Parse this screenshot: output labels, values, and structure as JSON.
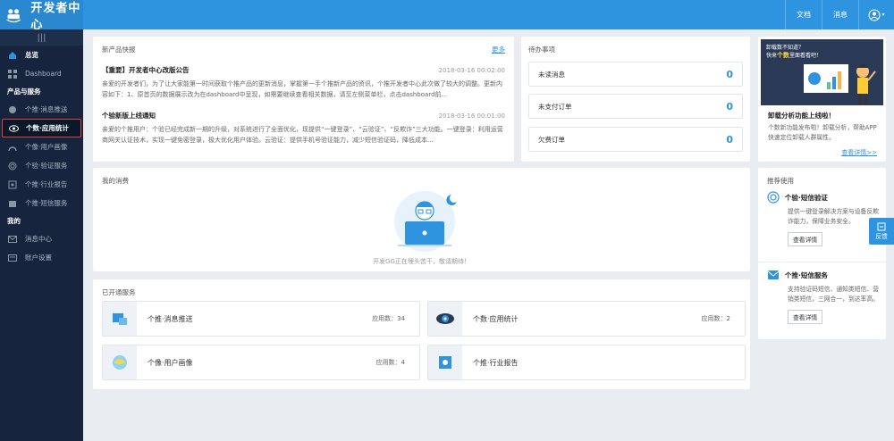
{
  "app": {
    "title": "开发者中心"
  },
  "topbar": {
    "docs": "文档",
    "messages": "消息"
  },
  "sidebar": {
    "collapse": "|||",
    "overview": "总览",
    "dashboard": "Dashboard",
    "group_products": "产品与服务",
    "products": [
      {
        "label": "个推·消息推送"
      },
      {
        "label": "个数·应用统计"
      },
      {
        "label": "个像·用户画像"
      },
      {
        "label": "个验·验证服务"
      },
      {
        "label": "个推·行业报告"
      },
      {
        "label": "个推·短信服务"
      }
    ],
    "group_mine": "我的",
    "mine": [
      {
        "label": "消息中心"
      },
      {
        "label": "账户设置"
      }
    ]
  },
  "news": {
    "title": "新产品快报",
    "more": "更多",
    "items": [
      {
        "title": "【重要】开发者中心改版公告",
        "date": "2018-03-16 00:02:00",
        "body": "亲爱的开发者们，为了让大家能第一时间获取个推产品的更新消息，掌握第一手个推新产品的资讯，个推开发者中心此次做了较大的调整。更新内容如下：1、原首页的数据展示改为在dashboard中呈现，如需要继续查看相关数据，请至左侧菜单栏，点击dashboard前..."
      },
      {
        "title": "个验新版上线通知",
        "date": "2018-03-16 00:01:00",
        "body": "亲爱的个推用户：个验已经完成新一期的升级，对系统进行了全面优化，现提供“一键登录”、“云验证”、“反欺诈”三大功能。一键登录：利用运营商网关认证技术，实现一键免密登录，极大优化用户体验。云验证：提供手机号验证能力，减少短信验证码，降低成本..."
      }
    ]
  },
  "todo": {
    "title": "待办事项",
    "items": [
      {
        "label": "未读消息",
        "count": "0"
      },
      {
        "label": "未支付订单",
        "count": "0"
      },
      {
        "label": "欠费订单",
        "count": "0"
      }
    ]
  },
  "promo": {
    "banner_line1": "卸载数不知道？",
    "banner_line2a": "快来",
    "banner_line2b": "个数",
    "banner_line2c": "里面看看吧！",
    "heading": "卸载分析功能上线啦！",
    "desc": "个数新功能发布啦！卸载分析，帮助APP快速定位卸载人群属性。",
    "link": "查看详情>>"
  },
  "consume": {
    "title": "我的消费",
    "caption": "开发GG正在埋头苦干，敬请期待！"
  },
  "services": {
    "title": "已开通服务",
    "items": [
      {
        "name": "个推·消息推送",
        "count": "应用数：34"
      },
      {
        "name": "个数·应用统计",
        "count": "应用数：2"
      },
      {
        "name": "个像·用户画像",
        "count": "应用数：4"
      },
      {
        "name": "个推·行业报告",
        "count": ""
      }
    ]
  },
  "recommend": {
    "title": "推荐使用",
    "items": [
      {
        "name": "个验·短信验证",
        "desc": "提供一键登录解决方案与设备反欺诈能力，保障业务安全。",
        "button": "查看详情"
      },
      {
        "name": "个推·短信服务",
        "desc": "支持验证码短信、通知类短信、营销类短信，三网合一，到达率高。",
        "button": "查看详情"
      }
    ]
  },
  "feedback": {
    "label": "反馈"
  },
  "colors": {
    "primary": "#2f94e0",
    "sidebar": "#16253d",
    "active_border": "#e0413b"
  }
}
